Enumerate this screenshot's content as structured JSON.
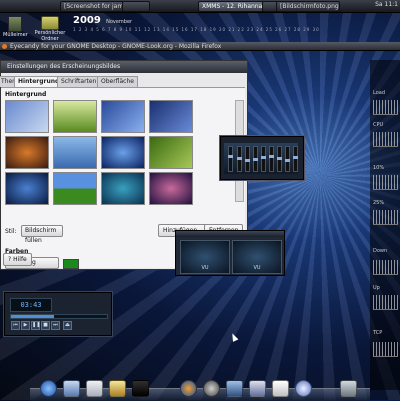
{
  "top_panel": {
    "tasks": [
      "[Screenshot for jame...",
      "",
      "XMMS - 12. Rihanna -",
      "",
      "[Bildschirmfoto.png...]"
    ],
    "clock": "Sa 11:1"
  },
  "desktop": {
    "icons": [
      {
        "label": "Mülleimer",
        "icon": "folder-icon"
      },
      {
        "label": "Persönlicher Ordner",
        "icon": "folder-icon"
      }
    ],
    "calendar": {
      "year": "2009",
      "month": "November",
      "days": "1 2 3 4 5 6 7 8 9 10 11 12 13 14 15 16 17 18 19 20 21 22 23 24 25 26 27 28 29 30"
    }
  },
  "firefox": {
    "title": "Eyecandy for your GNOME Desktop - GNOME-Look.org - Mozilla Firefox"
  },
  "appearance_dialog": {
    "title": "Einstellungen des Erscheinungsbildes",
    "tabs": [
      "Thema",
      "Hintergrund",
      "Schriftarten",
      "Oberfläche"
    ],
    "active_tab": "Hintergrund",
    "section_heading": "Hintergrund",
    "style_label": "Stil:",
    "style_value": "Bildschirm füllen",
    "add_button": "Hinzufügen...",
    "remove_button": "Entfernen",
    "colors_heading": "Farben",
    "color_mode": "Einfarbig",
    "color_value": "#1a8a1a",
    "help_button": "Hilfe"
  },
  "player": {
    "time": "03:43",
    "progress": 0.45,
    "buttons": [
      "prev-icon",
      "play-icon",
      "pause-icon",
      "stop-icon",
      "next-icon",
      "eject-icon"
    ]
  },
  "mixer": {
    "left_label": "VU",
    "right_label": "VU"
  },
  "conky": {
    "labels": [
      "Load",
      "CPU",
      "10%",
      "25%",
      "Down",
      "Up",
      "TCP"
    ]
  },
  "dock": {
    "icons": [
      "finder-icon",
      "home-icon",
      "text-editor-icon",
      "pencil-icon",
      "terminal-icon",
      "firefox-icon",
      "media-icon",
      "network-icon",
      "display-icon",
      "calendar-icon",
      "help-icon",
      "trash-icon"
    ]
  }
}
